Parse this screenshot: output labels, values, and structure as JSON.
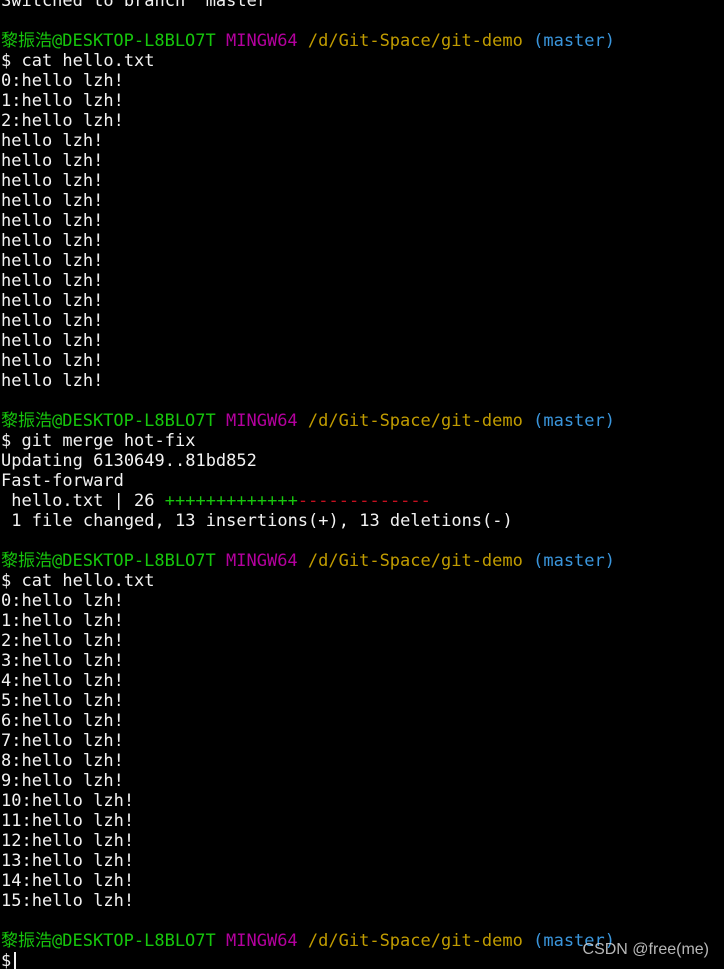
{
  "prompt": {
    "user_host": "黎振浩@DESKTOP-L8BLO7T",
    "system": "MINGW64",
    "path": "/d/Git-Space/git-demo",
    "branch": "(master)"
  },
  "history": {
    "switched_line": "Switched to branch 'master'"
  },
  "block1": {
    "command": "$ cat hello.txt",
    "output": [
      "0:hello lzh!",
      "1:hello lzh!",
      "2:hello lzh!",
      "hello lzh!",
      "hello lzh!",
      "hello lzh!",
      "hello lzh!",
      "hello lzh!",
      "hello lzh!",
      "hello lzh!",
      "hello lzh!",
      "hello lzh!",
      "hello lzh!",
      "hello lzh!",
      "hello lzh!",
      "hello lzh!"
    ]
  },
  "block2": {
    "command": "$ git merge hot-fix",
    "updating": "Updating 6130649..81bd852",
    "fast_forward": "Fast-forward",
    "stat_prefix": " hello.txt | 26 ",
    "stat_plus": "+++++++++++++",
    "stat_minus": "-------------",
    "summary": " 1 file changed, 13 insertions(+), 13 deletions(-)"
  },
  "block3": {
    "command": "$ cat hello.txt",
    "output": [
      "0:hello lzh!",
      "1:hello lzh!",
      "2:hello lzh!",
      "3:hello lzh!",
      "4:hello lzh!",
      "5:hello lzh!",
      "6:hello lzh!",
      "7:hello lzh!",
      "8:hello lzh!",
      "9:hello lzh!",
      "10:hello lzh!",
      "11:hello lzh!",
      "12:hello lzh!",
      "13:hello lzh!",
      "14:hello lzh!",
      "15:hello lzh!"
    ]
  },
  "final_prompt": {
    "dollar": "$"
  },
  "watermark": {
    "text": "CSDN @free(me)"
  },
  "colors": {
    "background": "#000000",
    "foreground": "#f2f2f2",
    "user_host": "#16c60c",
    "system": "#b4009e",
    "path": "#c19c00",
    "branch": "#3a96dd",
    "diff_plus": "#16c60c",
    "diff_minus": "#c50f1f"
  }
}
